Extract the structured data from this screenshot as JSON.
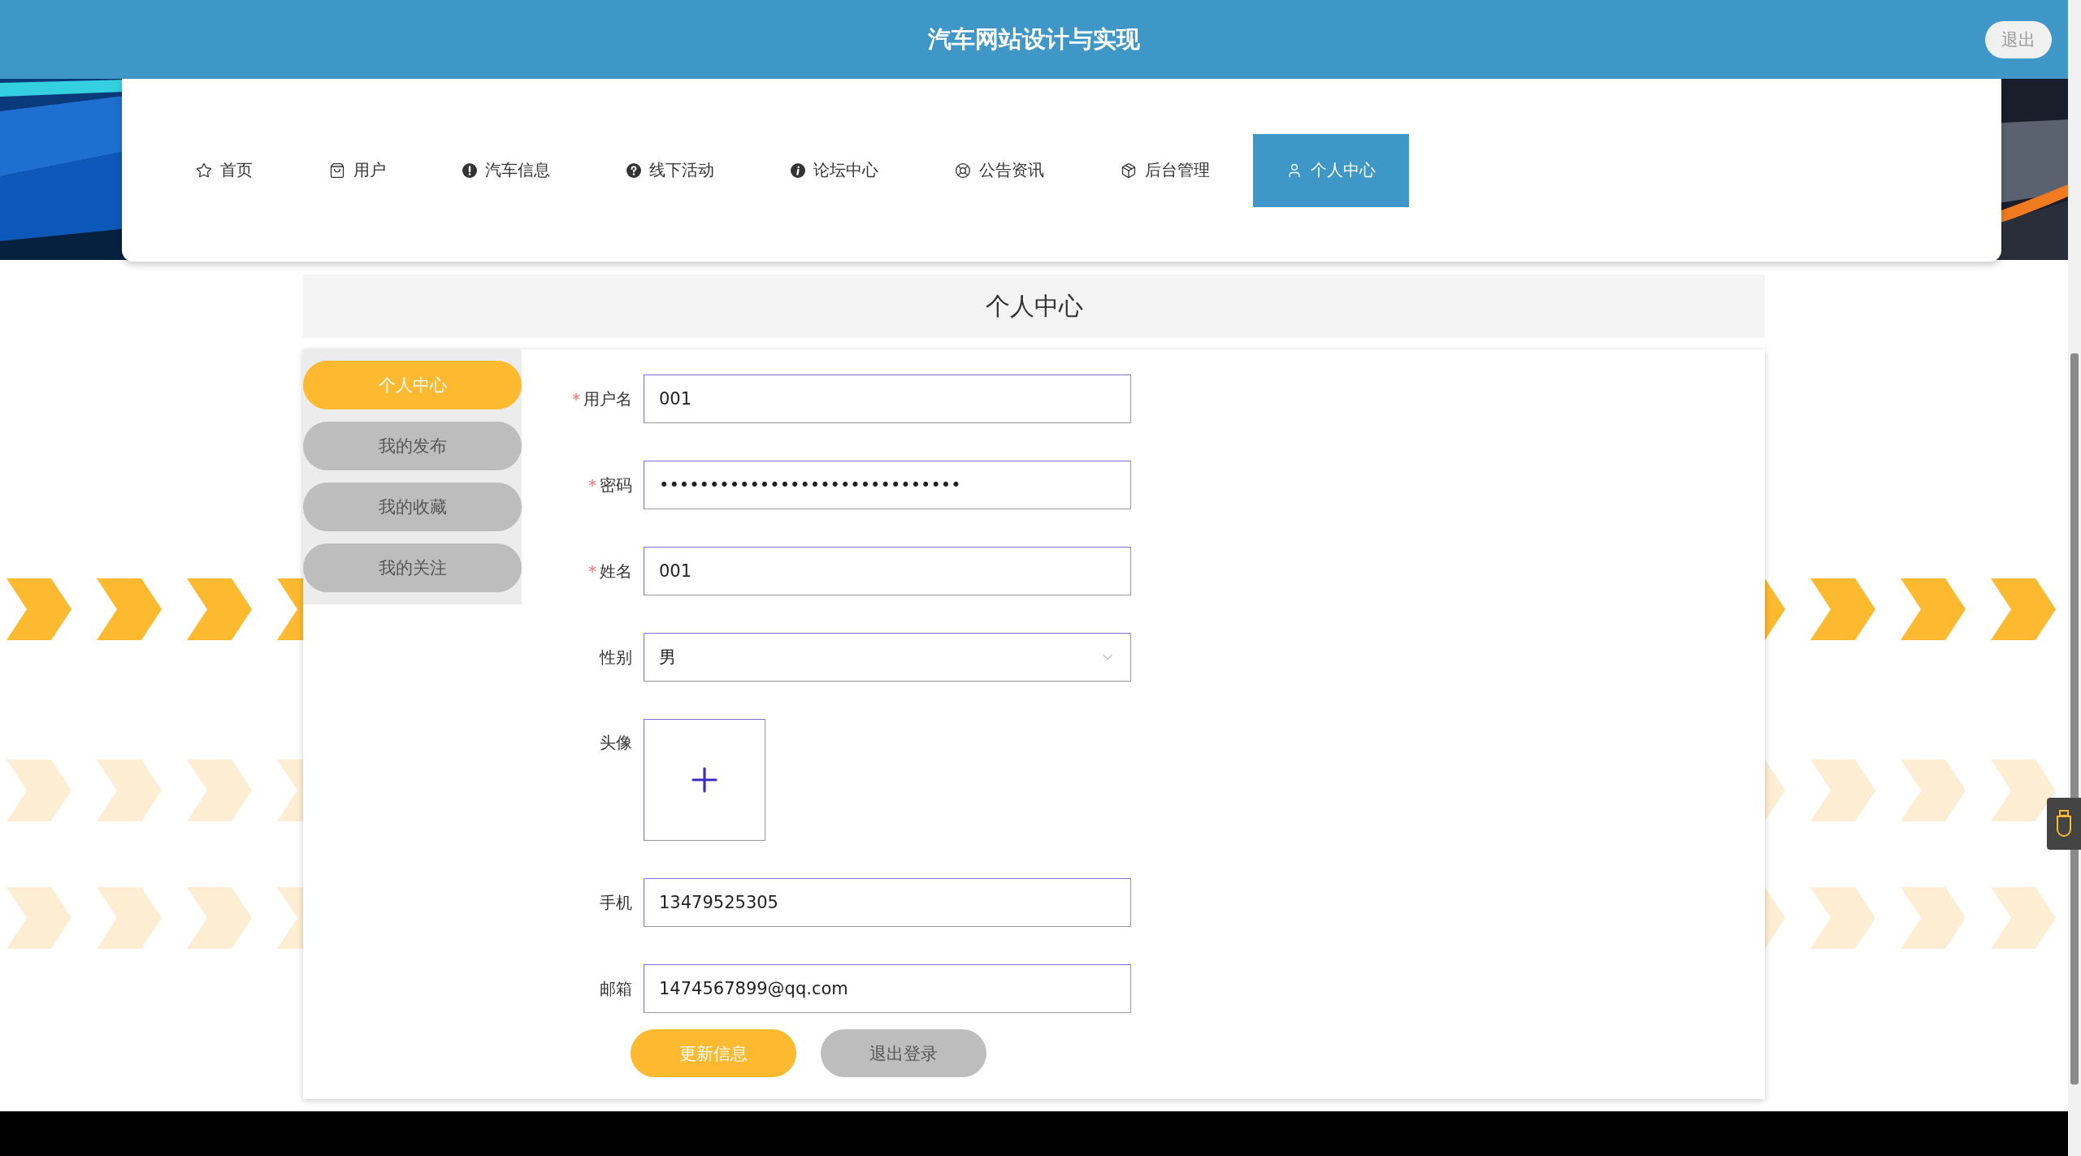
{
  "header": {
    "title": "汽车网站设计与实现",
    "logout": "退出"
  },
  "nav": [
    {
      "label": "首页",
      "selected": false
    },
    {
      "label": "用户",
      "selected": false
    },
    {
      "label": "汽车信息",
      "selected": false
    },
    {
      "label": "线下活动",
      "selected": false
    },
    {
      "label": "论坛中心",
      "selected": false
    },
    {
      "label": "公告资讯",
      "selected": false
    },
    {
      "label": "后台管理",
      "selected": false
    },
    {
      "label": "个人中心",
      "selected": true
    }
  ],
  "page_title": "个人中心",
  "side_menu": [
    {
      "label": "个人中心",
      "selected": true
    },
    {
      "label": "我的发布",
      "selected": false
    },
    {
      "label": "我的收藏",
      "selected": false
    },
    {
      "label": "我的关注",
      "selected": false
    }
  ],
  "form": {
    "fields": [
      {
        "kind": "text",
        "label": "用户名",
        "required_mark": "*",
        "value": "001"
      },
      {
        "kind": "text",
        "label": "密码",
        "required_mark": "*",
        "value": "••••••••••••••••••••••••••••••"
      },
      {
        "kind": "text",
        "label": "姓名",
        "required_mark": "*",
        "value": "001"
      },
      {
        "kind": "select",
        "label": "性别",
        "value": "男"
      },
      {
        "kind": "upload",
        "label": "头像"
      },
      {
        "kind": "text",
        "label": "手机",
        "value": "13479525305"
      },
      {
        "kind": "text",
        "label": "邮箱",
        "value": "1474567899@qq.com"
      }
    ]
  },
  "buttons": [
    {
      "label": "更新信息",
      "kind": "primary"
    },
    {
      "label": "退出登录",
      "kind": "secondary"
    }
  ]
}
